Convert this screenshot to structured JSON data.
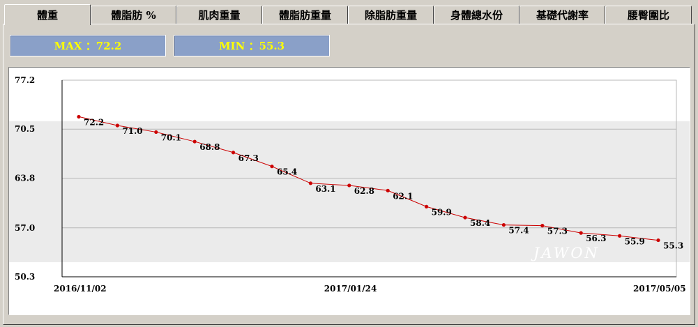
{
  "tabs": [
    {
      "label": "體重",
      "active": true
    },
    {
      "label": "體脂肪 %",
      "active": false
    },
    {
      "label": "肌肉重量",
      "active": false
    },
    {
      "label": "體脂肪重量",
      "active": false
    },
    {
      "label": "除脂肪重量",
      "active": false
    },
    {
      "label": "身體總水份",
      "active": false
    },
    {
      "label": "基礎代謝率",
      "active": false
    },
    {
      "label": "腰臀圍比",
      "active": false
    }
  ],
  "stats": {
    "max_text": "MAX ：72.2",
    "min_text": "MIN ：55.3"
  },
  "colors": {
    "line": "#cc0000",
    "band": "#ebebeb",
    "stat_bg": "#8aa0c8",
    "stat_text": "#ffff00"
  },
  "chart_data": {
    "type": "line",
    "watermark": "JAWON",
    "y_ticks": [
      "77.2",
      "70.5",
      "63.8",
      "57.0",
      "50.3"
    ],
    "ylim": [
      50.3,
      77.2
    ],
    "x_ticks": [
      "2016/11/02",
      "2017/01/24",
      "2017/05/05"
    ],
    "grid": "horizontal",
    "band_range": [
      52.3,
      71.6
    ],
    "series": [
      {
        "values": [
          72.2,
          71.0,
          70.1,
          68.8,
          67.3,
          65.4,
          63.1,
          62.8,
          62.1,
          59.9,
          58.4,
          57.4,
          57.3,
          56.3,
          55.9,
          55.3
        ],
        "labels": [
          "72.2",
          "71.0",
          "70.1",
          "68.8",
          "67.3",
          "65.4",
          "63.1",
          "62.8",
          "62.1",
          "59.9",
          "58.4",
          "57.4",
          "57.3",
          "56.3",
          "55.9",
          "55.3"
        ]
      }
    ]
  }
}
